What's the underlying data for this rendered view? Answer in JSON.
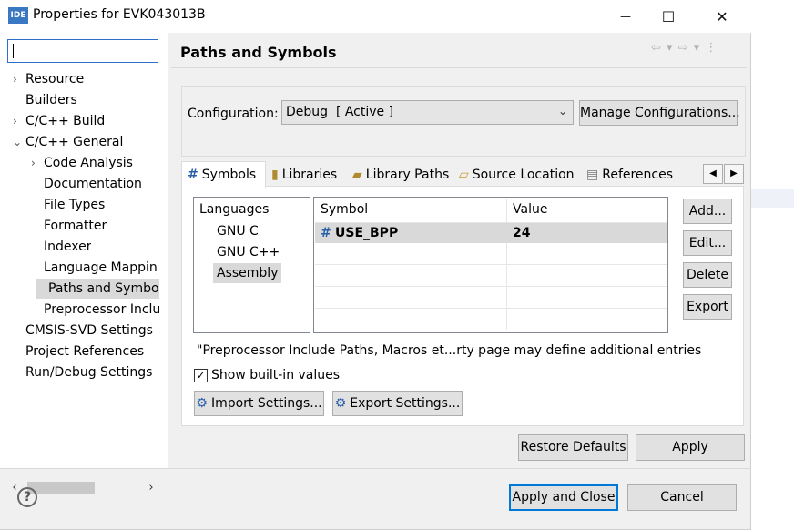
{
  "window": {
    "title": "Properties for EVK043013B",
    "app_icon": "IDE",
    "minimize": "—",
    "maximize": "☐",
    "close": "✕"
  },
  "filter": {
    "value": ""
  },
  "tree": {
    "items": [
      {
        "label": "Resource",
        "twisty": "›"
      },
      {
        "label": "Builders",
        "twisty": ""
      },
      {
        "label": "C/C++ Build",
        "twisty": "›"
      },
      {
        "label": "C/C++ General",
        "twisty": "⌄"
      },
      {
        "label": "Code Analysis",
        "twisty": "›"
      },
      {
        "label": "Documentation",
        "twisty": ""
      },
      {
        "label": "File Types",
        "twisty": ""
      },
      {
        "label": "Formatter",
        "twisty": ""
      },
      {
        "label": "Indexer",
        "twisty": ""
      },
      {
        "label": "Language Mappin",
        "twisty": ""
      },
      {
        "label": "Paths and Symbols",
        "twisty": ""
      },
      {
        "label": "Preprocessor Inclu",
        "twisty": ""
      },
      {
        "label": "CMSIS-SVD Settings",
        "twisty": ""
      },
      {
        "label": "Project References",
        "twisty": ""
      },
      {
        "label": "Run/Debug Settings",
        "twisty": ""
      }
    ],
    "selected": "Paths and Symbols"
  },
  "scroll": {
    "left": "‹",
    "right": "›"
  },
  "page": {
    "title": "Paths and Symbols",
    "nav_icons": "⇦ ▾ ⇨ ▾ ⋮"
  },
  "config": {
    "label": "Configuration:",
    "value": "Debug  [ Active ]",
    "manage_label": "Manage Configurations..."
  },
  "tabs": [
    {
      "label": "Symbols",
      "icon": "#"
    },
    {
      "label": "Libraries",
      "icon": "▮"
    },
    {
      "label": "Library Paths",
      "icon": "▰"
    },
    {
      "label": "Source Location",
      "icon": "▱"
    },
    {
      "label": "References",
      "icon": "▤"
    }
  ],
  "tab_scroll": {
    "left": "◀",
    "right": "▶"
  },
  "languages": {
    "header": "Languages",
    "items": [
      "GNU C",
      "GNU C++",
      "Assembly"
    ],
    "selected": "Assembly"
  },
  "symbols": {
    "columns": [
      "Symbol",
      "Value"
    ],
    "rows": [
      {
        "icon": "#",
        "symbol": "USE_BPP",
        "value": "24"
      }
    ]
  },
  "side_buttons": {
    "add": "Add...",
    "edit": "Edit...",
    "delete": "Delete",
    "export": "Export"
  },
  "note": "\"Preprocessor Include Paths, Macros et...rty page may define additional entries",
  "show_builtin": {
    "label": "Show built-in values",
    "checked": true
  },
  "import_label": "Import Settings...",
  "export_label": "Export Settings...",
  "restore_label": "Restore Defaults",
  "apply_label": "Apply",
  "apply_close_label": "Apply and Close",
  "cancel_label": "Cancel",
  "help_label": "?"
}
